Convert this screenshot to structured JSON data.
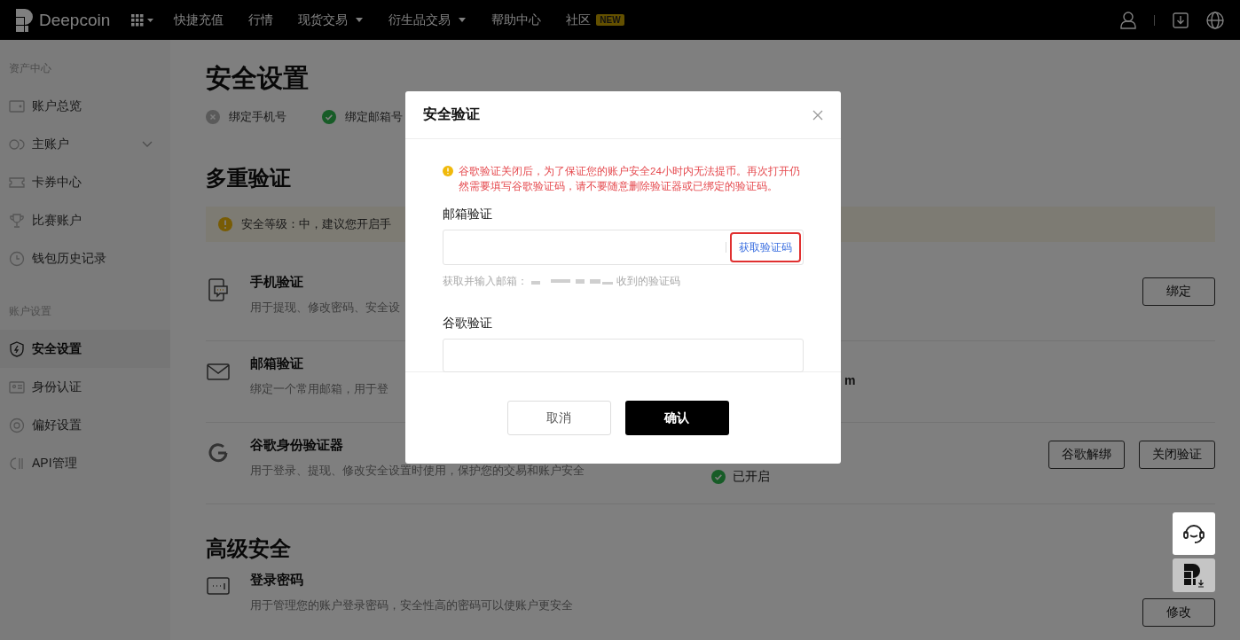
{
  "nav": {
    "logo": "Deepcoin",
    "items": [
      {
        "label": "快捷充值",
        "dropdown": false
      },
      {
        "label": "行情",
        "dropdown": false
      },
      {
        "label": "现货交易",
        "dropdown": true
      },
      {
        "label": "衍生品交易",
        "dropdown": true
      },
      {
        "label": "帮助中心",
        "dropdown": false
      },
      {
        "label": "社区",
        "dropdown": false,
        "badge": "NEW"
      }
    ]
  },
  "sidebar": {
    "sections": [
      {
        "title": "资产中心",
        "items": [
          {
            "label": "账户总览",
            "selected": false
          },
          {
            "label": "主账户",
            "selected": false,
            "expanded": false
          },
          {
            "label": "卡券中心",
            "selected": false
          },
          {
            "label": "比赛账户",
            "selected": false
          },
          {
            "label": "钱包历史记录",
            "selected": false
          }
        ]
      },
      {
        "title": "账户设置",
        "items": [
          {
            "label": "安全设置",
            "selected": true
          },
          {
            "label": "身份认证",
            "selected": false
          },
          {
            "label": "偏好设置",
            "selected": false
          },
          {
            "label": "API管理",
            "selected": false
          }
        ]
      }
    ]
  },
  "page": {
    "title": "安全设置",
    "steps": [
      {
        "label": "绑定手机号",
        "done": false
      },
      {
        "label": "绑定邮箱号",
        "done": true
      }
    ],
    "mfa_title": "多重验证",
    "notice": "安全等级：中，建议您开启手",
    "rows": [
      {
        "title": "手机验证",
        "desc": "用于提现、修改密码、安全设",
        "buttons": [
          "绑定"
        ]
      },
      {
        "title": "邮箱验证",
        "desc": "绑定一个常用邮箱，用于登",
        "status": {
          "kind": "email",
          "text": "m"
        },
        "buttons": []
      },
      {
        "title": "谷歌身份验证器",
        "desc": "用于登录、提现、修改安全设置时使用，保护您的交易和账户安全",
        "status": {
          "kind": "enabled",
          "text": "已开启"
        },
        "buttons": [
          "谷歌解绑",
          "关闭验证"
        ]
      }
    ],
    "advanced_title": "高级安全",
    "advanced_rows": [
      {
        "title": "登录密码",
        "desc": "用于管理您的账户登录密码，安全性高的密码可以使账户更安全",
        "buttons": [
          "修改"
        ]
      }
    ]
  },
  "modal": {
    "title": "安全验证",
    "warning": "谷歌验证关闭后，为了保证您的账户安全24小时内无法提币。再次打开仍然需要填写谷歌验证码，请不要随意删除验证器或已绑定的验证码。",
    "email_label": "邮箱验证",
    "get_code": "获取验证码",
    "hint_before": "获取并输入邮箱：",
    "hint_after": "收到的验证码",
    "google_label": "谷歌验证",
    "cancel": "取消",
    "confirm": "确认"
  }
}
